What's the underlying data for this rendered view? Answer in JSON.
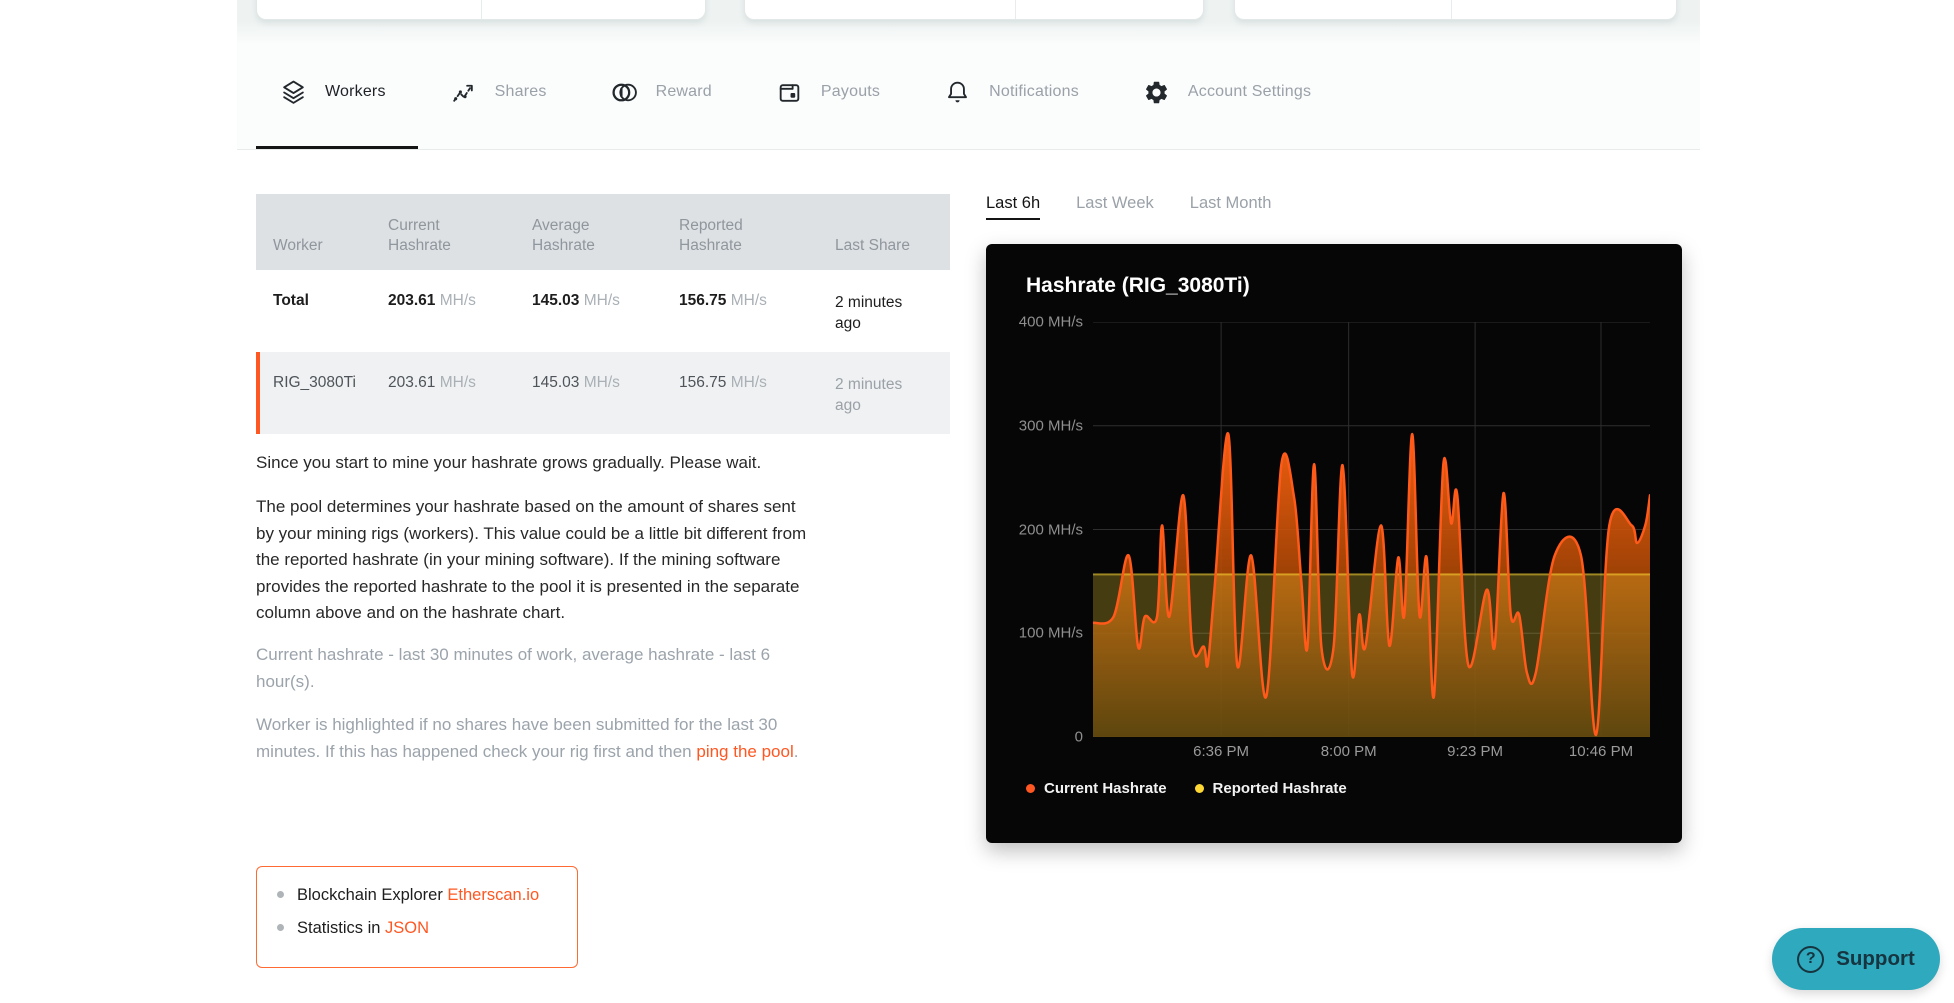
{
  "tabs": {
    "items": [
      {
        "label": "Workers",
        "icon": "layers-icon",
        "active": true
      },
      {
        "label": "Shares",
        "icon": "scatter-arrow-icon",
        "active": false
      },
      {
        "label": "Reward",
        "icon": "coins-icon",
        "active": false
      },
      {
        "label": "Payouts",
        "icon": "wallet-icon",
        "active": false
      },
      {
        "label": "Notifications",
        "icon": "bell-icon",
        "active": false
      },
      {
        "label": "Account Settings",
        "icon": "gear-icon",
        "active": false
      }
    ]
  },
  "table": {
    "unit": "MH/s",
    "headers": [
      "Worker",
      "Current Hashrate",
      "Average Hashrate",
      "Reported Hashrate",
      "Last Share"
    ],
    "rows": [
      {
        "worker": "Total",
        "current": "203.61",
        "average": "145.03",
        "reported": "156.75",
        "last_share": "2 minutes ago"
      },
      {
        "worker": "RIG_3080Ti",
        "current": "203.61",
        "average": "145.03",
        "reported": "156.75",
        "last_share": "2 minutes ago"
      }
    ]
  },
  "paragraphs": {
    "p1": "Since you start to mine your hashrate grows gradually. Please wait.",
    "p2": "The pool determines your hashrate based on the amount of shares sent by your mining rigs (workers). This value could be a little bit different from the reported hashrate (in your mining software). If the mining software provides the reported hashrate to the pool it is presented in the separate column above and on the hashrate chart.",
    "p3": "Current hashrate - last 30 minutes of work, average hashrate - last 6 hour(s).",
    "p4_before": "Worker is highlighted if no shares have been submitted for the last 30 minutes. If this has happened check your rig first and then ",
    "p4_link": "ping the pool",
    "p4_after": "."
  },
  "info_box": {
    "items": [
      {
        "before": "Blockchain Explorer ",
        "link": "Etherscan.io"
      },
      {
        "before": "Statistics in ",
        "link": "JSON"
      }
    ]
  },
  "range_tabs": {
    "items": [
      {
        "label": "Last 6h",
        "active": true
      },
      {
        "label": "Last Week",
        "active": false
      },
      {
        "label": "Last Month",
        "active": false
      }
    ]
  },
  "chart_data": {
    "type": "area",
    "title": "Hashrate (RIG_3080Ti)",
    "ylim": [
      0,
      400
    ],
    "grid": true,
    "legend_position": "bottom-left",
    "y_ticks": [
      {
        "value": 400,
        "label": "400 MH/s"
      },
      {
        "value": 300,
        "label": "300 MH/s"
      },
      {
        "value": 200,
        "label": "200 MH/s"
      },
      {
        "value": 100,
        "label": "100 MH/s"
      },
      {
        "value": 0,
        "label": "0"
      }
    ],
    "x_ticks": [
      {
        "pos": 23.0,
        "label": "6:36 PM"
      },
      {
        "pos": 45.9,
        "label": "8:00 PM"
      },
      {
        "pos": 68.6,
        "label": "9:23 PM"
      },
      {
        "pos": 91.2,
        "label": "10:46 PM"
      }
    ],
    "series": [
      {
        "name": "Current Hashrate",
        "color": "#ff5a1a",
        "points": [
          [
            0,
            110
          ],
          [
            3.7,
            116
          ],
          [
            6.4,
            175
          ],
          [
            8.1,
            87
          ],
          [
            9.3,
            116
          ],
          [
            11.5,
            116
          ],
          [
            12.4,
            204
          ],
          [
            13.7,
            116
          ],
          [
            16.2,
            233
          ],
          [
            17.8,
            88
          ],
          [
            19.9,
            87
          ],
          [
            20.6,
            70
          ],
          [
            21.8,
            142
          ],
          [
            24.3,
            292
          ],
          [
            25.9,
            69
          ],
          [
            28.4,
            175
          ],
          [
            31.1,
            39
          ],
          [
            33.8,
            262
          ],
          [
            36.1,
            231
          ],
          [
            37.4,
            150
          ],
          [
            38.5,
            87
          ],
          [
            39.7,
            263
          ],
          [
            41,
            87
          ],
          [
            43.2,
            87
          ],
          [
            44.8,
            262
          ],
          [
            46.5,
            62
          ],
          [
            47.8,
            118
          ],
          [
            48.9,
            87
          ],
          [
            51.7,
            204
          ],
          [
            53.2,
            88
          ],
          [
            54.8,
            173
          ],
          [
            55.9,
            118
          ],
          [
            57.3,
            292
          ],
          [
            58.6,
            118
          ],
          [
            59.9,
            173
          ],
          [
            61.2,
            39
          ],
          [
            62.9,
            263
          ],
          [
            64.3,
            206
          ],
          [
            65.4,
            233
          ],
          [
            67.4,
            69
          ],
          [
            70.7,
            142
          ],
          [
            72.1,
            87
          ],
          [
            73.7,
            235
          ],
          [
            75,
            118
          ],
          [
            76.5,
            118
          ],
          [
            77.9,
            62
          ],
          [
            79.5,
            62
          ],
          [
            82.9,
            175
          ],
          [
            87.6,
            175
          ],
          [
            90.3,
            2
          ],
          [
            92.7,
            204
          ],
          [
            96.7,
            204
          ],
          [
            97.7,
            187
          ],
          [
            99.2,
            205
          ],
          [
            100,
            233
          ]
        ]
      },
      {
        "name": "Reported Hashrate",
        "color": "#fdd835",
        "points": [
          [
            0,
            156.75
          ],
          [
            100,
            156.75
          ]
        ]
      }
    ]
  },
  "support": {
    "label": "Support"
  },
  "colors": {
    "accent": "#ff5722",
    "current_series": "#ff5a1a",
    "reported_series": "#fdd835",
    "support_bg": "#2fa9bd",
    "table_header_bg": "#dde1e4",
    "row_highlight_bg": "#f0f1f2",
    "chart_bg": "#060606"
  }
}
